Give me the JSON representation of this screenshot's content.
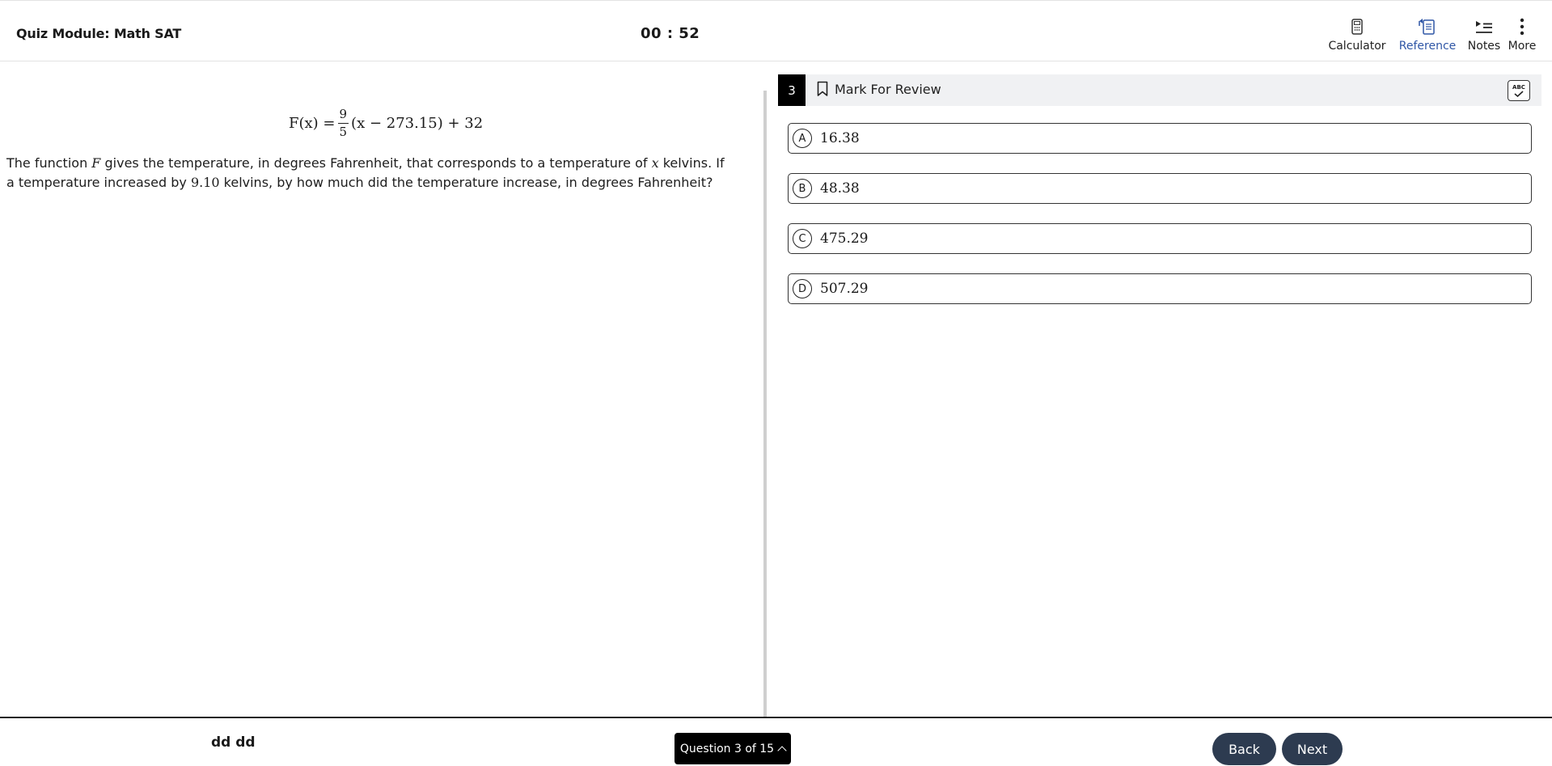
{
  "header": {
    "title": "Quiz Module: Math SAT",
    "timer": "00 : 52",
    "tools": {
      "calculator": "Calculator",
      "reference": "Reference",
      "notes": "Notes",
      "more": "More"
    },
    "active_color": "#2f56a6"
  },
  "question": {
    "formula": {
      "lhs": "F(x) =",
      "numerator": "9",
      "denominator": "5",
      "rhs": "(x − 273.15) + 32"
    },
    "text_parts": {
      "p1": "The function ",
      "f": "F",
      "p2": " gives the temperature, in degrees Fahrenheit, that corresponds to a temperature of ",
      "x": "x",
      "p3": " kelvins. If a temperature increased by ",
      "num": "9.10",
      "p4": " kelvins, by how much did the temperature increase, in degrees Fahrenheit?"
    }
  },
  "answer_panel": {
    "question_number": "3",
    "mark_label": "Mark For Review",
    "abc_label": "ABC",
    "choices": [
      {
        "letter": "A",
        "value": "16.38"
      },
      {
        "letter": "B",
        "value": "48.38"
      },
      {
        "letter": "C",
        "value": "475.29"
      },
      {
        "letter": "D",
        "value": "507.29"
      }
    ]
  },
  "footer": {
    "student_name": "dd dd",
    "question_nav": "Question 3 of 15",
    "back_label": "Back",
    "next_label": "Next",
    "button_color": "#2d3b50"
  }
}
